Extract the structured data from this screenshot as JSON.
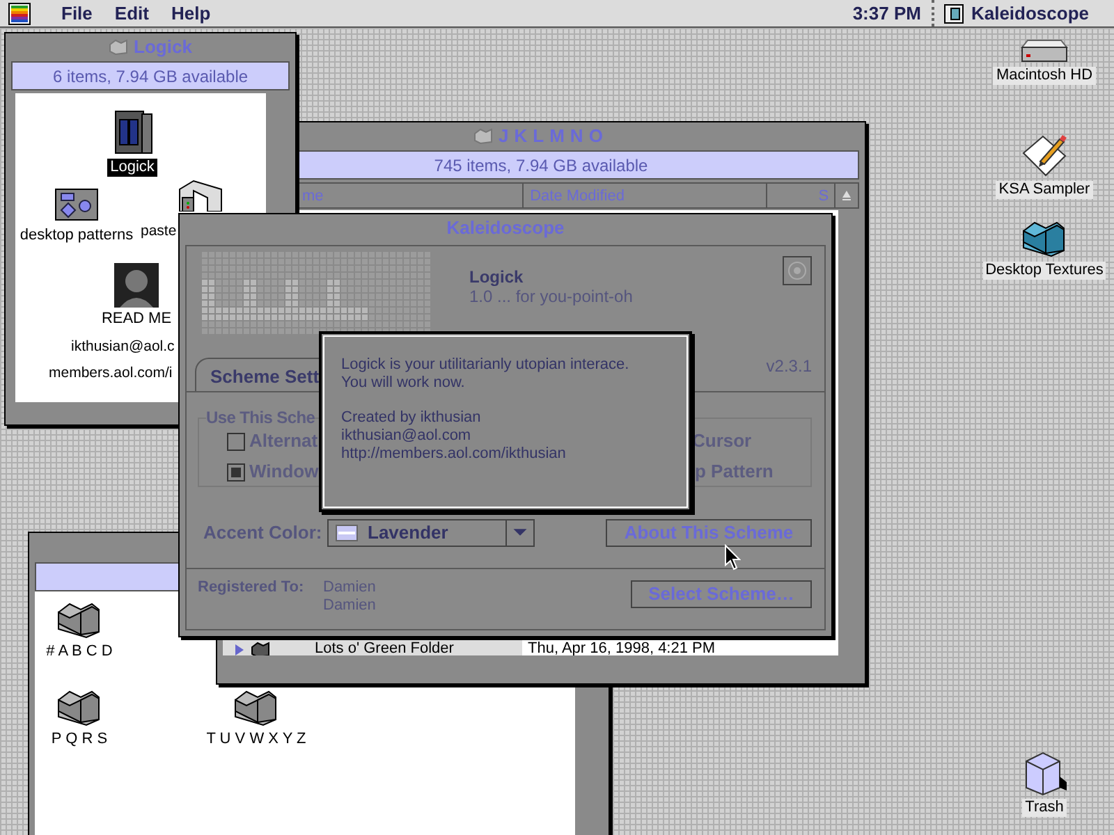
{
  "menu_bar": {
    "menus": [
      "File",
      "Edit",
      "Help"
    ],
    "clock": "3:37 PM",
    "active_app": "Kaleidoscope"
  },
  "desktop_icons": [
    {
      "label": "Macintosh HD",
      "kind": "disk"
    },
    {
      "label": "KSA Sampler",
      "kind": "document"
    },
    {
      "label": "Desktop Textures",
      "kind": "blocks"
    },
    {
      "label": "Trash",
      "kind": "trash"
    }
  ],
  "logick_window": {
    "title": "Logick",
    "info": "6 items, 7.94 GB available",
    "icons": [
      {
        "label": "Logick",
        "kind": "app",
        "selected": true
      },
      {
        "label": "desktop patterns",
        "kind": "patterns",
        "selected": false
      },
      {
        "label": "paste",
        "kind": "server",
        "selected": false
      },
      {
        "label": "READ ME",
        "kind": "readme",
        "selected": false
      },
      {
        "label": "ikthusian@aol.c",
        "kind": "none",
        "selected": false
      },
      {
        "label": "members.aol.com/i",
        "kind": "none",
        "selected": false
      }
    ]
  },
  "jklmno_window": {
    "title": "JKLMNO",
    "info": "745 items, 7.94 GB available",
    "columns": [
      "me",
      "Date Modified",
      "S"
    ],
    "rows": [
      {
        "name": "Lots o' Green Folder",
        "date": "Thu, Apr 16, 1998, 4:21 PM"
      }
    ]
  },
  "folders_window": {
    "icons": [
      {
        "label": "# A B C D"
      },
      {
        "label": "P Q R S"
      },
      {
        "label": "T U V W X Y Z"
      }
    ]
  },
  "kaleidoscope_window": {
    "title": "Kaleidoscope",
    "scheme_name": "Logick",
    "tagline": "1.0 ... for you-point-oh",
    "tabs": [
      {
        "label": "Scheme Sett",
        "selected": true
      }
    ],
    "version": "v2.3.1",
    "group_label": "Use This Sche",
    "options_left": [
      {
        "label": "Alternat",
        "checked": false
      },
      {
        "label": "Window",
        "checked": true
      }
    ],
    "options_right": [
      "Cursor",
      "p Pattern"
    ],
    "accent_label": "Accent Color:",
    "accent_value": "Lavender",
    "about_button": "About This Scheme",
    "registered_label": "Registered To:",
    "registered_names": [
      "Damien",
      "Damien"
    ],
    "select_button": "Select Scheme…"
  },
  "about_dialog": {
    "lines": [
      "Logick is your utilitarianly utopian interace.",
      "You will work now."
    ],
    "credits": [
      "Created by ikthusian",
      "ikthusian@aol.com",
      "http://members.aol.com/ikthusian"
    ]
  }
}
